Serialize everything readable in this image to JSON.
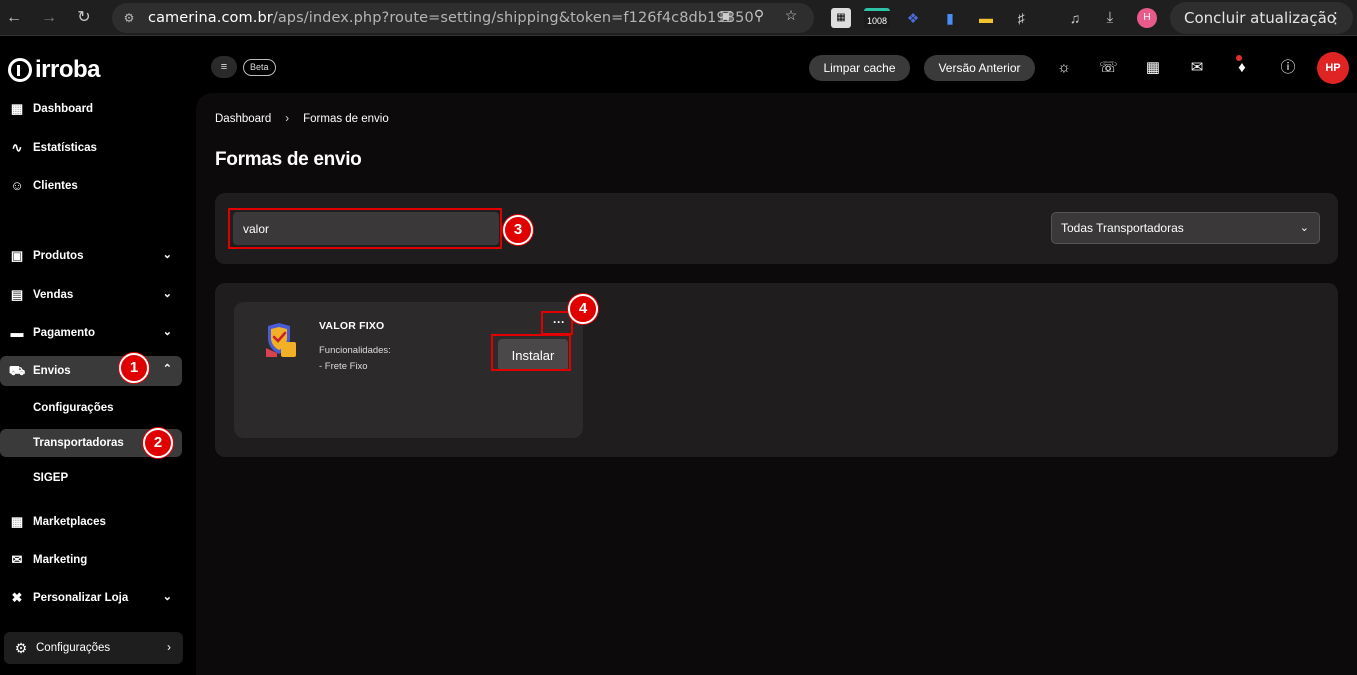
{
  "browser": {
    "url_domain": "camerina.com.br",
    "url_path": "/aps/index.php?route=setting/shipping&token=f126f4c8db19850",
    "ext_counter": "1008",
    "profile_initial": "H",
    "update_label": "Concluir atualização"
  },
  "brand": {
    "name": "irroba"
  },
  "sidebar": {
    "items": [
      {
        "label": "Dashboard"
      },
      {
        "label": "Estatísticas"
      },
      {
        "label": "Clientes"
      },
      {
        "label": "Produtos"
      },
      {
        "label": "Vendas"
      },
      {
        "label": "Pagamento"
      },
      {
        "label": "Envios"
      },
      {
        "label": "Marketplaces"
      },
      {
        "label": "Marketing"
      },
      {
        "label": "Personalizar Loja"
      }
    ],
    "envios_sub": [
      {
        "label": "Configurações"
      },
      {
        "label": "Transportadoras"
      },
      {
        "label": "SIGEP"
      }
    ],
    "footer_config": "Configurações"
  },
  "header": {
    "beta_label": "Beta",
    "clear_cache": "Limpar cache",
    "previous_version": "Versão Anterior",
    "avatar_initials": "HP"
  },
  "breadcrumb": {
    "home": "Dashboard",
    "current": "Formas de envio"
  },
  "page": {
    "title": "Formas de envio"
  },
  "filters": {
    "search_value": "valor",
    "carrier_select": "Todas Transportadoras"
  },
  "results": [
    {
      "title": "VALOR FIXO",
      "features_label": "Funcionalidades:",
      "features": [
        "- Frete Fixo"
      ],
      "more_label": "···",
      "install_label": "Instalar"
    }
  ],
  "annotations": [
    "1",
    "2",
    "3",
    "4"
  ],
  "colors": {
    "accent_red": "#e00000",
    "panel": "#1f1d1d",
    "card": "#2c2a2a"
  }
}
